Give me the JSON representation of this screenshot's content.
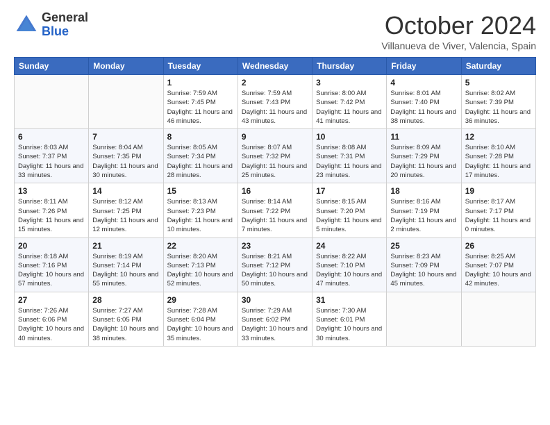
{
  "logo": {
    "general": "General",
    "blue": "Blue"
  },
  "header": {
    "month": "October 2024",
    "subtitle": "Villanueva de Viver, Valencia, Spain"
  },
  "weekdays": [
    "Sunday",
    "Monday",
    "Tuesday",
    "Wednesday",
    "Thursday",
    "Friday",
    "Saturday"
  ],
  "weeks": [
    [
      {
        "day": "",
        "info": ""
      },
      {
        "day": "",
        "info": ""
      },
      {
        "day": "1",
        "info": "Sunrise: 7:59 AM\nSunset: 7:45 PM\nDaylight: 11 hours and 46 minutes."
      },
      {
        "day": "2",
        "info": "Sunrise: 7:59 AM\nSunset: 7:43 PM\nDaylight: 11 hours and 43 minutes."
      },
      {
        "day": "3",
        "info": "Sunrise: 8:00 AM\nSunset: 7:42 PM\nDaylight: 11 hours and 41 minutes."
      },
      {
        "day": "4",
        "info": "Sunrise: 8:01 AM\nSunset: 7:40 PM\nDaylight: 11 hours and 38 minutes."
      },
      {
        "day": "5",
        "info": "Sunrise: 8:02 AM\nSunset: 7:39 PM\nDaylight: 11 hours and 36 minutes."
      }
    ],
    [
      {
        "day": "6",
        "info": "Sunrise: 8:03 AM\nSunset: 7:37 PM\nDaylight: 11 hours and 33 minutes."
      },
      {
        "day": "7",
        "info": "Sunrise: 8:04 AM\nSunset: 7:35 PM\nDaylight: 11 hours and 30 minutes."
      },
      {
        "day": "8",
        "info": "Sunrise: 8:05 AM\nSunset: 7:34 PM\nDaylight: 11 hours and 28 minutes."
      },
      {
        "day": "9",
        "info": "Sunrise: 8:07 AM\nSunset: 7:32 PM\nDaylight: 11 hours and 25 minutes."
      },
      {
        "day": "10",
        "info": "Sunrise: 8:08 AM\nSunset: 7:31 PM\nDaylight: 11 hours and 23 minutes."
      },
      {
        "day": "11",
        "info": "Sunrise: 8:09 AM\nSunset: 7:29 PM\nDaylight: 11 hours and 20 minutes."
      },
      {
        "day": "12",
        "info": "Sunrise: 8:10 AM\nSunset: 7:28 PM\nDaylight: 11 hours and 17 minutes."
      }
    ],
    [
      {
        "day": "13",
        "info": "Sunrise: 8:11 AM\nSunset: 7:26 PM\nDaylight: 11 hours and 15 minutes."
      },
      {
        "day": "14",
        "info": "Sunrise: 8:12 AM\nSunset: 7:25 PM\nDaylight: 11 hours and 12 minutes."
      },
      {
        "day": "15",
        "info": "Sunrise: 8:13 AM\nSunset: 7:23 PM\nDaylight: 11 hours and 10 minutes."
      },
      {
        "day": "16",
        "info": "Sunrise: 8:14 AM\nSunset: 7:22 PM\nDaylight: 11 hours and 7 minutes."
      },
      {
        "day": "17",
        "info": "Sunrise: 8:15 AM\nSunset: 7:20 PM\nDaylight: 11 hours and 5 minutes."
      },
      {
        "day": "18",
        "info": "Sunrise: 8:16 AM\nSunset: 7:19 PM\nDaylight: 11 hours and 2 minutes."
      },
      {
        "day": "19",
        "info": "Sunrise: 8:17 AM\nSunset: 7:17 PM\nDaylight: 11 hours and 0 minutes."
      }
    ],
    [
      {
        "day": "20",
        "info": "Sunrise: 8:18 AM\nSunset: 7:16 PM\nDaylight: 10 hours and 57 minutes."
      },
      {
        "day": "21",
        "info": "Sunrise: 8:19 AM\nSunset: 7:14 PM\nDaylight: 10 hours and 55 minutes."
      },
      {
        "day": "22",
        "info": "Sunrise: 8:20 AM\nSunset: 7:13 PM\nDaylight: 10 hours and 52 minutes."
      },
      {
        "day": "23",
        "info": "Sunrise: 8:21 AM\nSunset: 7:12 PM\nDaylight: 10 hours and 50 minutes."
      },
      {
        "day": "24",
        "info": "Sunrise: 8:22 AM\nSunset: 7:10 PM\nDaylight: 10 hours and 47 minutes."
      },
      {
        "day": "25",
        "info": "Sunrise: 8:23 AM\nSunset: 7:09 PM\nDaylight: 10 hours and 45 minutes."
      },
      {
        "day": "26",
        "info": "Sunrise: 8:25 AM\nSunset: 7:07 PM\nDaylight: 10 hours and 42 minutes."
      }
    ],
    [
      {
        "day": "27",
        "info": "Sunrise: 7:26 AM\nSunset: 6:06 PM\nDaylight: 10 hours and 40 minutes."
      },
      {
        "day": "28",
        "info": "Sunrise: 7:27 AM\nSunset: 6:05 PM\nDaylight: 10 hours and 38 minutes."
      },
      {
        "day": "29",
        "info": "Sunrise: 7:28 AM\nSunset: 6:04 PM\nDaylight: 10 hours and 35 minutes."
      },
      {
        "day": "30",
        "info": "Sunrise: 7:29 AM\nSunset: 6:02 PM\nDaylight: 10 hours and 33 minutes."
      },
      {
        "day": "31",
        "info": "Sunrise: 7:30 AM\nSunset: 6:01 PM\nDaylight: 10 hours and 30 minutes."
      },
      {
        "day": "",
        "info": ""
      },
      {
        "day": "",
        "info": ""
      }
    ]
  ]
}
